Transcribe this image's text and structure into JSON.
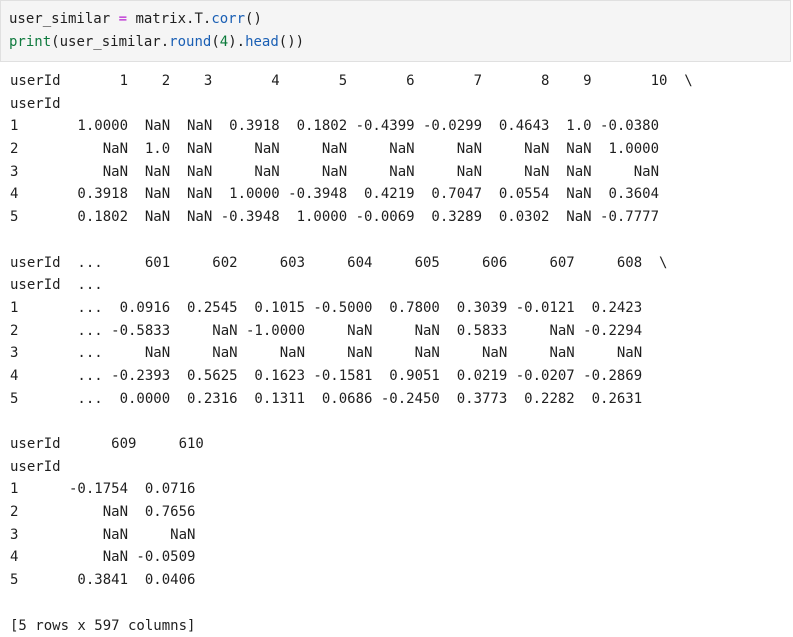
{
  "code_cell": {
    "line1": {
      "var": "user_similar ",
      "op": "=",
      "rest": " matrix.T.",
      "func": "corr",
      "tail": "()"
    },
    "line2": {
      "builtin": "print",
      "open": "(user_similar.",
      "func1": "round",
      "paren_open": "(",
      "num": "4",
      "mid": ").",
      "func2": "head",
      "tail": "())"
    }
  },
  "output": {
    "lines": [
      "userId       1    2    3       4       5       6       7       8    9       10  \\",
      "userId",
      "1       1.0000  NaN  NaN  0.3918  0.1802 -0.4399 -0.0299  0.4643  1.0 -0.0380",
      "2          NaN  1.0  NaN     NaN     NaN     NaN     NaN     NaN  NaN  1.0000",
      "3          NaN  NaN  NaN     NaN     NaN     NaN     NaN     NaN  NaN     NaN",
      "4       0.3918  NaN  NaN  1.0000 -0.3948  0.4219  0.7047  0.0554  NaN  0.3604",
      "5       0.1802  NaN  NaN -0.3948  1.0000 -0.0069  0.3289  0.0302  NaN -0.7777",
      "",
      "userId  ...     601     602     603     604     605     606     607     608  \\",
      "userId  ...",
      "1       ...  0.0916  0.2545  0.1015 -0.5000  0.7800  0.3039 -0.0121  0.2423",
      "2       ... -0.5833     NaN -1.0000     NaN     NaN  0.5833     NaN -0.2294",
      "3       ...     NaN     NaN     NaN     NaN     NaN     NaN     NaN     NaN",
      "4       ... -0.2393  0.5625  0.1623 -0.1581  0.9051  0.0219 -0.0207 -0.2869",
      "5       ...  0.0000  0.2316  0.1311  0.0686 -0.2450  0.3773  0.2282  0.2631",
      "",
      "userId      609     610",
      "userId",
      "1      -0.1754  0.0716",
      "2          NaN  0.7656",
      "3          NaN     NaN",
      "4          NaN -0.0509",
      "5       0.3841  0.0406",
      "",
      "[5 rows x 597 columns]"
    ]
  }
}
